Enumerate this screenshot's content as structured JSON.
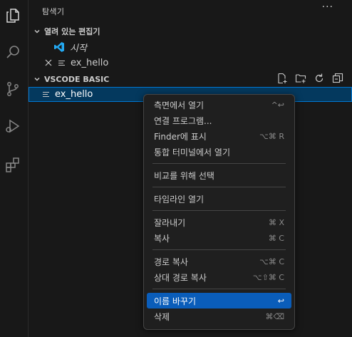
{
  "sidebar": {
    "title": "탐색기",
    "more": "···"
  },
  "open_editors": {
    "header": "열려 있는 편집기",
    "items": [
      {
        "label": "시작",
        "icon": "vscode-logo-icon"
      },
      {
        "label": "ex_hello",
        "icon": "file-lines-icon"
      }
    ]
  },
  "workspace": {
    "header": "VSCODE BASIC",
    "items": [
      {
        "label": "ex_hello",
        "icon": "file-lines-icon"
      }
    ]
  },
  "context_menu": {
    "groups": [
      [
        {
          "label": "측면에서 열기",
          "shortcut": "^↩"
        },
        {
          "label": "연결 프로그램...",
          "shortcut": ""
        },
        {
          "label": "Finder에 표시",
          "shortcut": "⌥⌘ R"
        },
        {
          "label": "통합 터미널에서 열기",
          "shortcut": ""
        }
      ],
      [
        {
          "label": "비교를 위해 선택",
          "shortcut": ""
        }
      ],
      [
        {
          "label": "타임라인 열기",
          "shortcut": ""
        }
      ],
      [
        {
          "label": "잘라내기",
          "shortcut": "⌘ X"
        },
        {
          "label": "복사",
          "shortcut": "⌘ C"
        }
      ],
      [
        {
          "label": "경로 복사",
          "shortcut": "⌥⌘ C"
        },
        {
          "label": "상대 경로 복사",
          "shortcut": "⌥⇧⌘ C"
        }
      ],
      [
        {
          "label": "이름 바꾸기",
          "shortcut": "↩",
          "highlighted": true
        },
        {
          "label": "삭제",
          "shortcut": "⌘⌫"
        }
      ]
    ]
  },
  "colors": {
    "background": "#181818",
    "selection": "#04395e",
    "focus_border": "#0078d4",
    "menu_highlight": "#0a5dba",
    "vscode_blue": "#23a9f2"
  }
}
